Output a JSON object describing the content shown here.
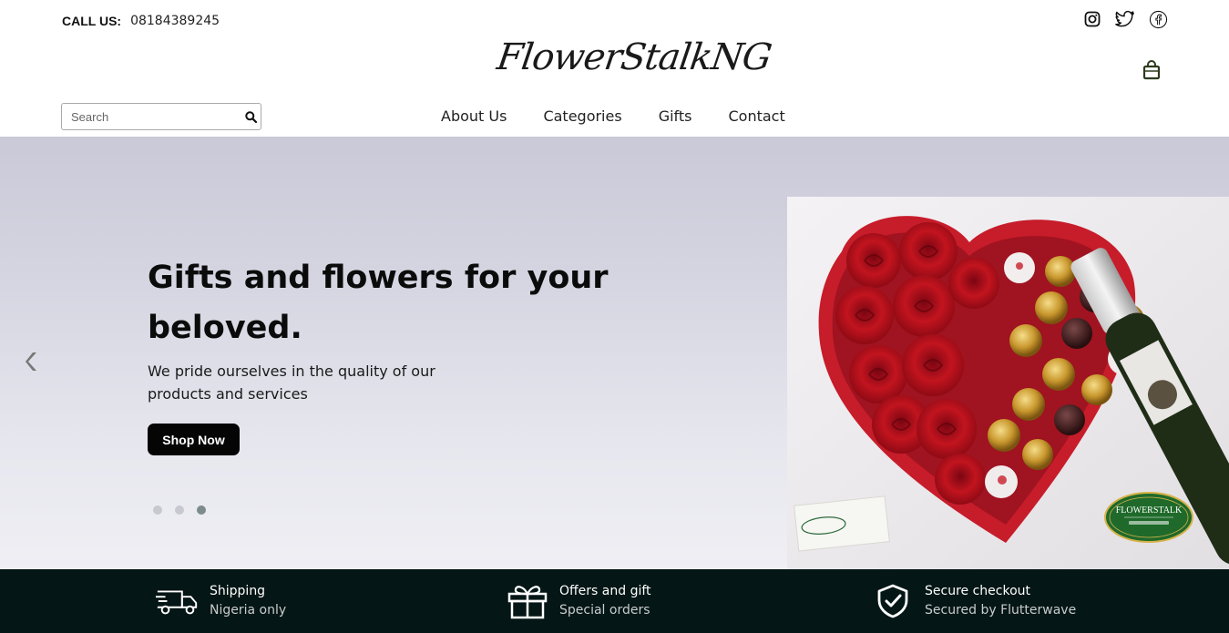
{
  "header": {
    "call_label": "CALL US:",
    "call_number": "08184389245",
    "logo_text": "FlowerStalkNG",
    "social_icons": [
      "instagram-icon",
      "twitter-icon",
      "facebook-icon"
    ],
    "cart_icon": "shopping-bag-icon"
  },
  "search": {
    "placeholder": "Search",
    "value": "",
    "icon": "search-icon"
  },
  "nav": {
    "items": [
      {
        "label": "About Us"
      },
      {
        "label": "Categories"
      },
      {
        "label": "Gifts"
      },
      {
        "label": "Contact"
      }
    ]
  },
  "hero": {
    "title": "Gifts and flowers for your beloved.",
    "subtitle": "We pride ourselves in the quality of our products and services",
    "cta_label": "Shop Now",
    "prev_icon": "chevron-left-icon",
    "slides_count": 3,
    "active_slide": 3,
    "image_alt": "heart box of red roses and chocolates with champagne",
    "badge_text": "FLOWERSTALK"
  },
  "features": [
    {
      "icon": "truck-icon",
      "title": "Shipping",
      "subtitle": "Nigeria only"
    },
    {
      "icon": "gift-icon",
      "title": "Offers and gift",
      "subtitle": "Special orders"
    },
    {
      "icon": "shield-check-icon",
      "title": "Secure checkout",
      "subtitle": "Secured by Flutterwave"
    }
  ],
  "colors": {
    "features_bg": "#041615",
    "button_bg": "#050505",
    "cart_color": "#2d3a1e",
    "dot_active": "#7d8b8a"
  }
}
